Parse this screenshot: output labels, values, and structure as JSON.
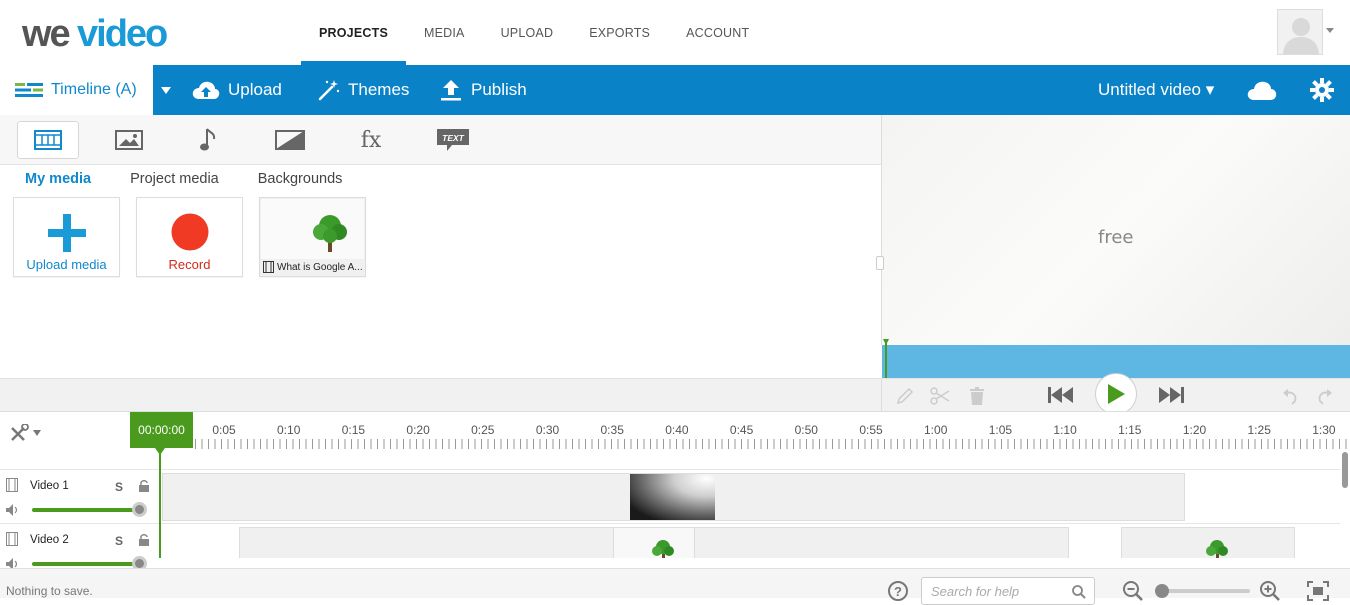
{
  "nav": {
    "logo_text": "weVideo",
    "links": [
      "PROJECTS",
      "MEDIA",
      "UPLOAD",
      "EXPORTS",
      "ACCOUNT"
    ],
    "active": "PROJECTS"
  },
  "toolbar": {
    "timeline_label": "Timeline (A)",
    "upload_label": "Upload",
    "themes_label": "Themes",
    "publish_label": "Publish",
    "project_title": "Untitled video ▾"
  },
  "media": {
    "tabs": [
      "video-icon",
      "image-icon",
      "music-icon",
      "transition-icon",
      "fx-icon",
      "text-icon"
    ],
    "fx_label": "fx",
    "text_label": "TEXT",
    "subtabs": [
      "My media",
      "Project media",
      "Backgrounds"
    ],
    "tiles": {
      "upload_label": "Upload media",
      "record_label": "Record",
      "clip_caption": "What is Google A..."
    }
  },
  "preview": {
    "overlay_text": "free",
    "progress": 0.0
  },
  "timeline": {
    "current_time": "00:00:00",
    "ticks": [
      "0:05",
      "0:10",
      "0:15",
      "0:20",
      "0:25",
      "0:30",
      "0:35",
      "0:40",
      "0:45",
      "0:50",
      "0:55",
      "1:00",
      "1:05",
      "1:10",
      "1:15",
      "1:20",
      "1:25",
      "1:30"
    ],
    "tracks": [
      {
        "name": "Video 1",
        "solo": "S"
      },
      {
        "name": "Video 2",
        "solo": "S"
      }
    ]
  },
  "status": {
    "message": "Nothing to save.",
    "help_icon": "?",
    "search_placeholder": "Search for help"
  },
  "colors": {
    "brand_blue": "#0a82c8",
    "accent_green": "#4a9a1e",
    "record_red": "#f03a24",
    "preview_bar": "#5eb6e3"
  }
}
